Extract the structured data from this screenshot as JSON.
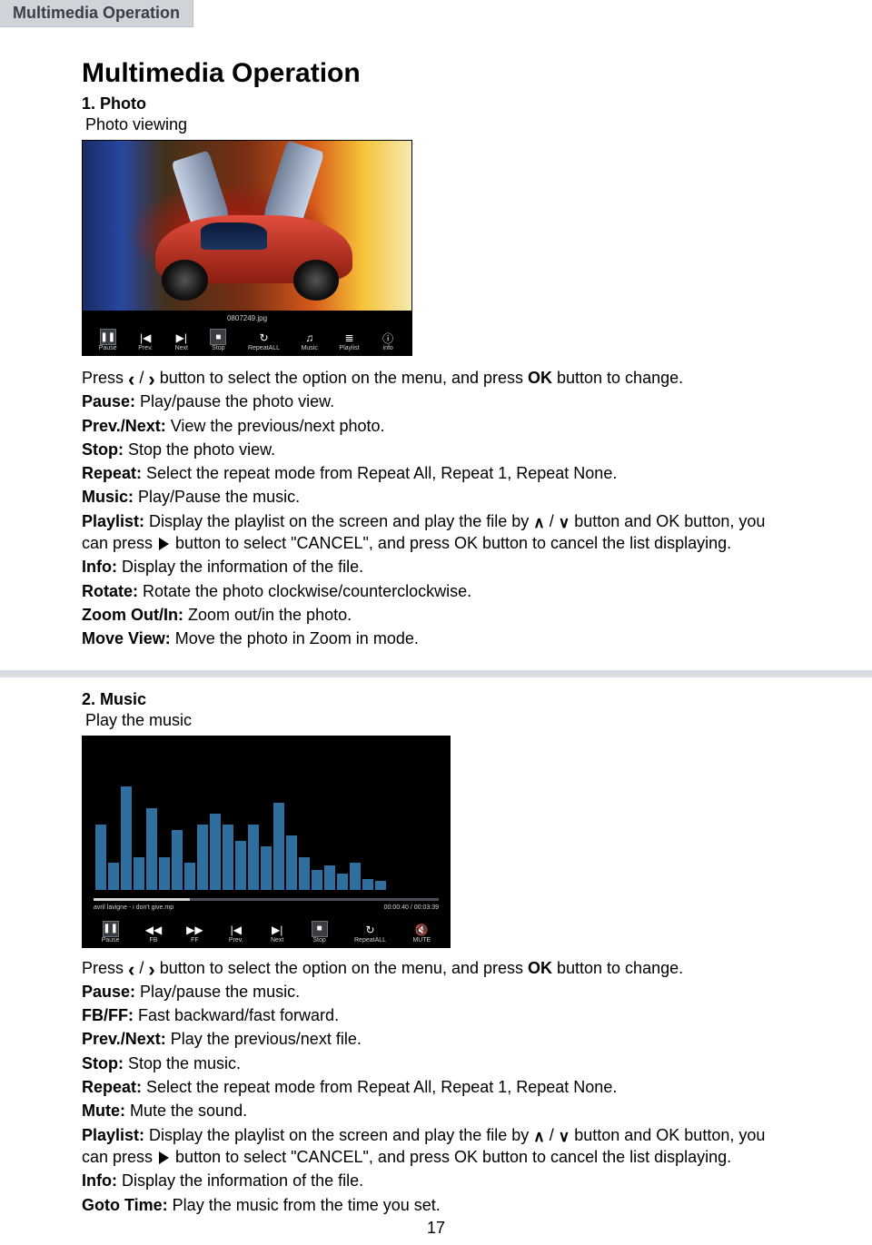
{
  "header_tab": "Multimedia Operation",
  "title": "Multimedia Operation",
  "page_number": "17",
  "photo": {
    "section_head": "1. Photo",
    "subtitle": "Photo viewing",
    "filename_label": "0807249.jpg",
    "toolbar": [
      {
        "icon": "pause",
        "label": "Pause"
      },
      {
        "icon": "prev",
        "label": "Prev."
      },
      {
        "icon": "next",
        "label": "Next"
      },
      {
        "icon": "stop",
        "label": "Stop"
      },
      {
        "icon": "repeat",
        "label": "RepeatALL"
      },
      {
        "icon": "music",
        "label": "Music"
      },
      {
        "icon": "playlist",
        "label": "Playlist"
      },
      {
        "icon": "info",
        "label": "info"
      }
    ],
    "intro_pre": "Press",
    "intro_post": "button to select the option on the menu, and press ",
    "intro_ok": "OK",
    "intro_tail": " button to change.",
    "lines": [
      {
        "label": "Pause:",
        "text": " Play/pause the photo view."
      },
      {
        "label": "Prev./Next:",
        "text": " View the previous/next photo."
      },
      {
        "label": "Stop:",
        "text": " Stop the photo view."
      },
      {
        "label": "Repeat:",
        "text": " Select the repeat mode from Repeat All, Repeat 1, Repeat None."
      },
      {
        "label": "Music:",
        "text": " Play/Pause the music."
      }
    ],
    "playlist_label": "Playlist:",
    "playlist_pre": " Display the playlist on the screen and play the file by  ",
    "playlist_mid": "  button and OK button, you can press ",
    "playlist_post": " button to select \"CANCEL\", and press OK button to cancel the list displaying.",
    "lines2": [
      {
        "label": "Info:",
        "text": " Display the information of the file."
      },
      {
        "label": "Rotate:",
        "text": " Rotate the photo clockwise/counterclockwise."
      },
      {
        "label": "Zoom Out/In:",
        "text": " Zoom out/in the photo."
      },
      {
        "label": "Move View:",
        "text": " Move the photo in Zoom in mode."
      }
    ]
  },
  "music": {
    "section_head": "2. Music",
    "subtitle": "Play the music",
    "track_label": "avril lavigne - i don't give.mp",
    "time_label": "00:00:40 / 00:03:39",
    "toolbar": [
      {
        "icon": "pause",
        "label": "Pause"
      },
      {
        "icon": "fb",
        "label": "FB"
      },
      {
        "icon": "ff",
        "label": "FF"
      },
      {
        "icon": "prev",
        "label": "Prev."
      },
      {
        "icon": "next",
        "label": "Next"
      },
      {
        "icon": "stop",
        "label": "Stop"
      },
      {
        "icon": "repeat",
        "label": "RepeatALL"
      },
      {
        "icon": "mute",
        "label": "MUTE"
      }
    ],
    "intro_pre": "Press",
    "intro_post": "button to select the option on the menu, and press ",
    "intro_ok": "OK",
    "intro_tail": " button to change.",
    "lines": [
      {
        "label": "Pause:",
        "text": " Play/pause the music."
      },
      {
        "label": "FB/FF:",
        "text": " Fast backward/fast forward."
      },
      {
        "label": "Prev./Next:",
        "text": " Play the previous/next file."
      },
      {
        "label": "Stop:",
        "text": " Stop the music."
      },
      {
        "label": "Repeat:",
        "text": " Select the repeat mode from Repeat All, Repeat 1, Repeat None."
      },
      {
        "label": "Mute:",
        "text": " Mute the sound."
      }
    ],
    "playlist_label": "Playlist:",
    "playlist_pre": " Display the playlist on the screen and play the file by ",
    "playlist_mid": " button and OK button, you can press ",
    "playlist_post": " button to select \"CANCEL\", and press OK button to cancel the list displaying.",
    "lines2": [
      {
        "label": "Info:",
        "text": " Display the information of the file."
      },
      {
        "label": "Goto Time:",
        "text": " Play the music from the time you set."
      }
    ]
  }
}
